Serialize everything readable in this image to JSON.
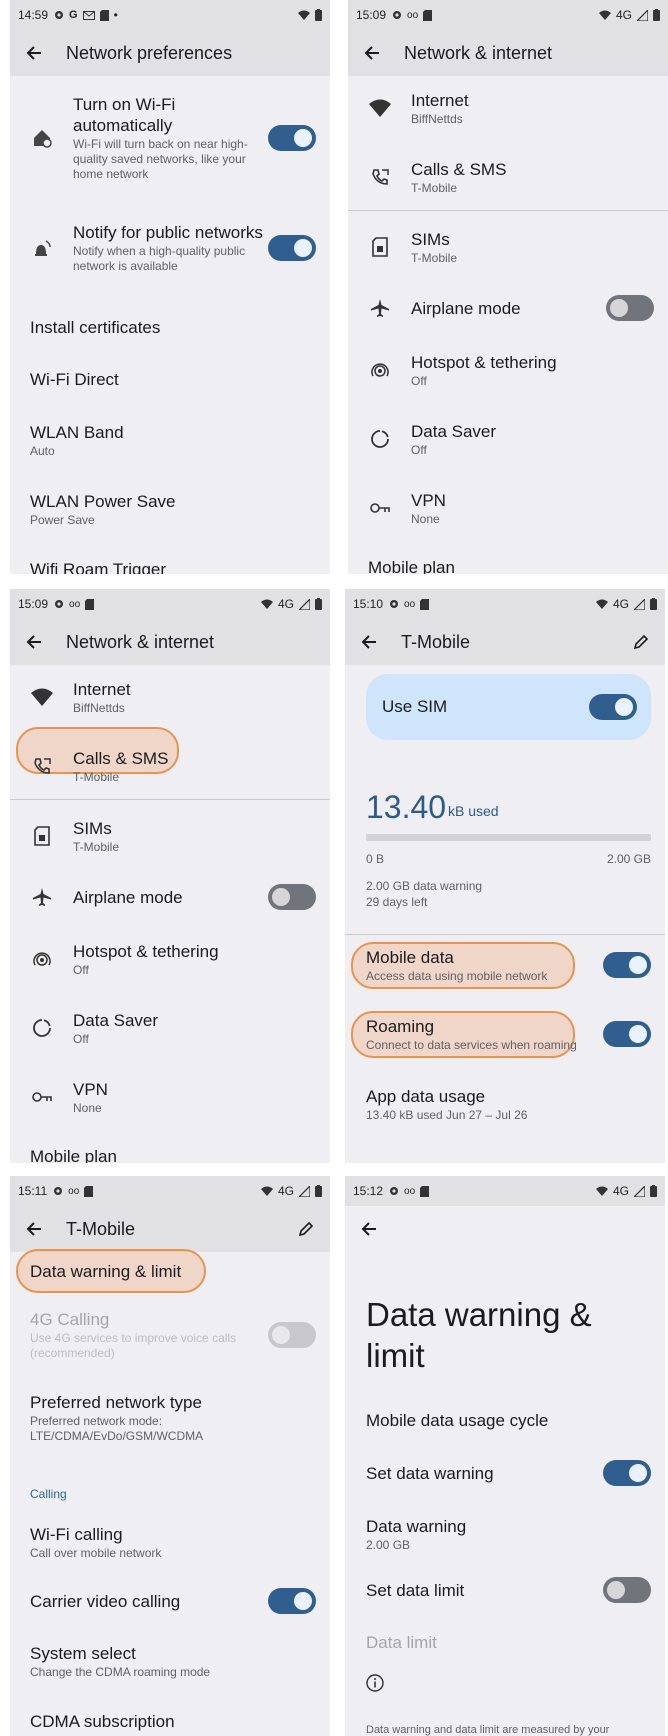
{
  "panels": {
    "p1": {
      "time": "14:59",
      "title": "Network preferences",
      "items": [
        {
          "label": "Turn on Wi-Fi automatically",
          "sub": "Wi-Fi will turn back on near high-quality saved networks, like your home network"
        },
        {
          "label": "Notify for public networks",
          "sub": "Notify when a high-quality public network is available"
        },
        {
          "label": "Install certificates"
        },
        {
          "label": "Wi-Fi Direct"
        },
        {
          "label": "WLAN Band",
          "sub": "Auto"
        },
        {
          "label": "WLAN Power Save",
          "sub": "Power Save"
        },
        {
          "label": "Wifi Roam Trigger"
        }
      ]
    },
    "p2": {
      "time": "15:09",
      "title": "Network & internet",
      "network": "4G",
      "items": [
        {
          "label": "Internet",
          "sub": "BiffNettds"
        },
        {
          "label": "Calls & SMS",
          "sub": "T-Mobile"
        },
        {
          "label": "SIMs",
          "sub": "T-Mobile"
        },
        {
          "label": "Airplane mode"
        },
        {
          "label": "Hotspot & tethering",
          "sub": "Off"
        },
        {
          "label": "Data Saver",
          "sub": "Off"
        },
        {
          "label": "VPN",
          "sub": "None"
        },
        {
          "label": "Mobile plan"
        }
      ]
    },
    "p3": {
      "time": "15:09",
      "title": "Network & internet",
      "network": "4G"
    },
    "p4": {
      "time": "15:10",
      "title": "T-Mobile",
      "network": "4G",
      "use_sim": "Use SIM",
      "usage_value": "13.40",
      "usage_unit": "kB used",
      "range_min": "0 B",
      "range_max": "2.00 GB",
      "warning": "2.00 GB data warning",
      "days_left": "29 days left",
      "items": [
        {
          "label": "Mobile data",
          "sub": "Access data using mobile network"
        },
        {
          "label": "Roaming",
          "sub": "Connect to data services when roaming"
        },
        {
          "label": "App data usage",
          "sub": "13.40 kB used Jun 27 – Jul 26"
        }
      ]
    },
    "p5": {
      "time": "15:11",
      "title": "T-Mobile",
      "network": "4G",
      "section_calling": "Calling",
      "items": [
        {
          "label": "Data warning & limit"
        },
        {
          "label": "4G Calling",
          "sub": "Use 4G services to improve voice calls (recommended)"
        },
        {
          "label": "Preferred network type",
          "sub": "Preferred network mode: LTE/CDMA/EvDo/GSM/WCDMA"
        },
        {
          "label": "Wi-Fi calling",
          "sub": "Call over mobile network"
        },
        {
          "label": "Carrier video calling"
        },
        {
          "label": "System select",
          "sub": "Change the CDMA roaming mode"
        },
        {
          "label": "CDMA subscription"
        }
      ]
    },
    "p6": {
      "time": "15:12",
      "network": "4G",
      "title": "Data warning & limit",
      "items": [
        {
          "label": "Mobile data usage cycle"
        },
        {
          "label": "Set data warning"
        },
        {
          "label": "Data warning",
          "sub": "2.00 GB"
        },
        {
          "label": "Set data limit"
        },
        {
          "label": "Data limit"
        }
      ],
      "footer": "Data warning and data limit are measured by your"
    }
  },
  "colors": {
    "accent": "#2f5e8f",
    "highlight": "#e8944f",
    "panel_bg": "#eeeef3",
    "bar_bg": "#e1e1e4"
  }
}
